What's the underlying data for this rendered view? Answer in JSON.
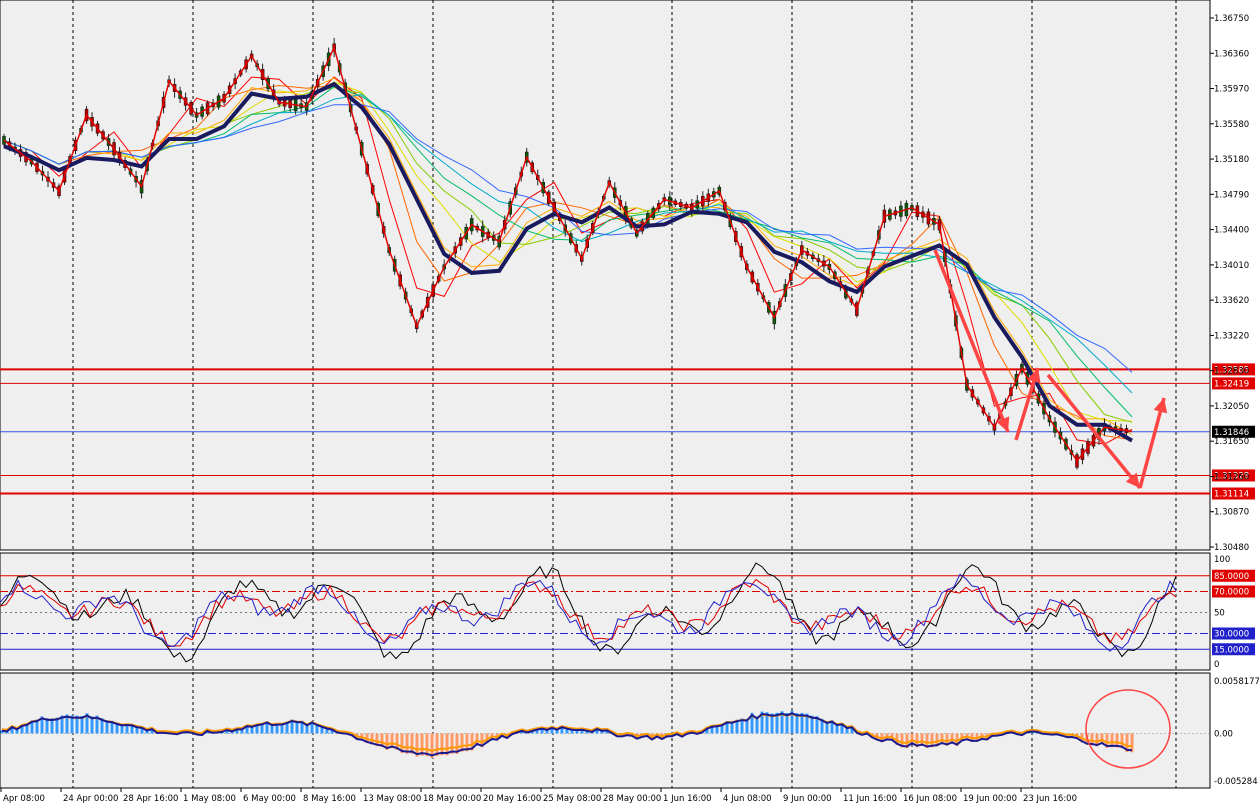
{
  "colors": {
    "background": "#ffffff",
    "plot_bg": "#efefef",
    "grid": "#000000",
    "candle_up": "#0a5a0a",
    "candle_down": "#c00000",
    "ma_slow": "#1a1a5e",
    "zigzag": "#e00000",
    "level_red": "#e00000",
    "current_price_line": "#3355dd",
    "stoch_main": "#000000",
    "stoch_red": "#e00000",
    "stoch_blue": "#2222cc",
    "macd_hist_pos": "#3399ff",
    "macd_hist_neg": "#ff9966",
    "macd_main": "#1a1a8e",
    "macd_signal": "#ff9900",
    "arrow": "#ff4444"
  },
  "x_axis": {
    "labels": [
      "Apr 08:00",
      "24 Apr 00:00",
      "28 Apr 16:00",
      "1 May 08:00",
      "6 May 00:00",
      "8 May 16:00",
      "13 May 08:00",
      "18 May 00:00",
      "20 May 16:00",
      "25 May 08:00",
      "28 May 00:00",
      "1 Jun 16:00",
      "4 Jun 08:00",
      "9 Jun 00:00",
      "11 Jun 16:00",
      "16 Jun 08:00",
      "19 Jun 00:00",
      "23 Jun 16:00"
    ]
  },
  "price_panel": {
    "tick_labels": [
      "1.36750",
      "1.36360",
      "1.35970",
      "1.35580",
      "1.35180",
      "1.34790",
      "1.34400",
      "1.34010",
      "1.33620",
      "1.33220",
      "1.32830",
      "1.32050",
      "1.31650",
      "1.31260",
      "1.30870",
      "1.30480"
    ],
    "levels": [
      {
        "label": "1.32585",
        "value": 1.32585,
        "style": "thick"
      },
      {
        "label": "1.32419",
        "value": 1.32419,
        "style": "thin"
      },
      {
        "label": "1.31328",
        "value": 1.31328,
        "style": "thin"
      },
      {
        "label": "1.31114",
        "value": 1.31114,
        "style": "thick"
      }
    ],
    "current_price": {
      "label": "1.31846",
      "value": 1.31846
    },
    "price_range": [
      1.3048,
      1.3675
    ]
  },
  "stoch_panel": {
    "tick_labels": [
      "100",
      "50",
      "0"
    ],
    "levels": [
      {
        "label": "85.0000",
        "value": 85,
        "color": "red",
        "dash": "solid"
      },
      {
        "label": "70.0000",
        "value": 70,
        "color": "red",
        "dash": "dashdot"
      },
      {
        "label": "30.0000",
        "value": 30,
        "color": "blue",
        "dash": "dashdot"
      },
      {
        "label": "15.0000",
        "value": 15,
        "color": "blue",
        "dash": "solid"
      }
    ],
    "fifty_level": 50
  },
  "macd_panel": {
    "tick_labels": [
      "0.0058177",
      "0.00",
      "-0.005284"
    ],
    "range": [
      -0.005284,
      0.0058177
    ]
  },
  "chart_data": {
    "type": "line",
    "title": "",
    "xlabel": "",
    "ylabel": "",
    "ylim": [
      1.3048,
      1.3675
    ],
    "series": [
      {
        "values": [
          1.353,
          1.3505,
          1.347,
          1.356,
          1.352,
          1.3475,
          1.36,
          1.356,
          1.358,
          1.363,
          1.3575,
          1.357,
          1.364,
          1.352,
          1.34,
          1.331,
          1.338,
          1.343,
          1.341,
          1.351,
          1.345,
          1.339,
          1.348,
          1.342,
          1.346,
          1.345,
          1.347,
          1.338,
          1.332,
          1.34,
          1.338,
          1.333,
          1.344,
          1.345,
          1.343,
          1.324,
          1.319,
          1.326,
          1.32,
          1.315,
          1.319,
          1.3185
        ]
      }
    ]
  }
}
